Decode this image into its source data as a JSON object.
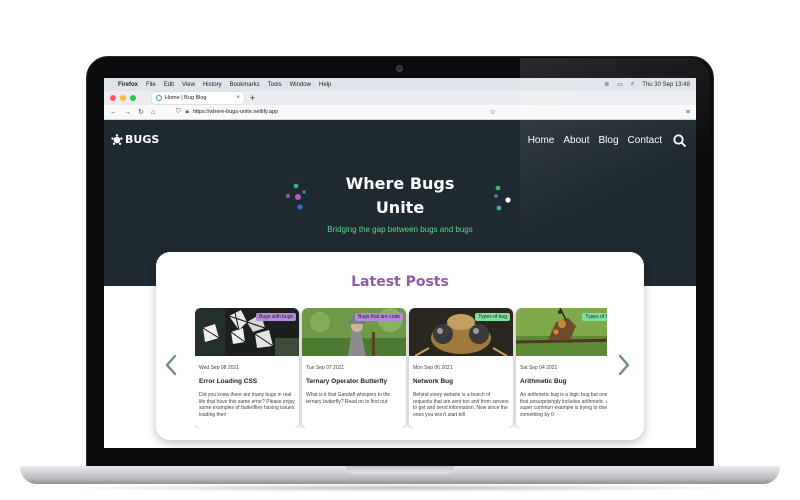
{
  "menubar": {
    "app": "Firefox",
    "items": [
      "File",
      "Edit",
      "View",
      "History",
      "Bookmarks",
      "Tools",
      "Window",
      "Help"
    ],
    "clock": "Thu 30 Sep  13:48"
  },
  "browser": {
    "tab_title": "Home | Bug Blog",
    "new_tab_label": "+",
    "url": "https://where-bugs-unite.netlify.app"
  },
  "site": {
    "logo_text": "BUGS",
    "nav": [
      "Home",
      "About",
      "Blog",
      "Contact"
    ],
    "hero": {
      "title_line1": "Where Bugs",
      "title_line2": "Unite",
      "subtitle": "Bridging the gap between bugs and bugs"
    },
    "latest": {
      "title": "Latest Posts",
      "posts": [
        {
          "tag": "Bugs with bugs",
          "date": "Wed Sep 08 2021",
          "title": "Error Loading CSS",
          "excerpt": "Did you know there are many bugs in real life that have this same error? Please enjoy some examples of butterflies having issues loading their"
        },
        {
          "tag": "Bugs that are code",
          "date": "Tue Sep 07 2021",
          "title": "Ternary Operator Butterfly",
          "excerpt": "What is it that Gandalf whispers to the ternary butterfly? Read on to find out"
        },
        {
          "tag": "Types of bug",
          "date": "Mon Sep 06 2021",
          "title": "Network Bug",
          "excerpt": "Behind every website is a bunch of requests that are sent too and from servers to get and send information. Now since the ones you won't start tell"
        },
        {
          "tag": "Types of bug",
          "date": "Sat Sep 04 2021",
          "title": "Arithmetic Bug",
          "excerpt": "An arithmetic bug is a logic bug but one that unsurprisingly includes arithmetic. A super common example is trying to divide something by 0"
        }
      ]
    }
  },
  "icons": {
    "prev": "chevron-left-icon",
    "next": "chevron-right-icon",
    "search": "search-icon"
  },
  "colors": {
    "hero_bg": "#1f2a30",
    "accent_green": "#5cd68a",
    "heading_purple": "#8e5ba6",
    "tag_purple": "#b48bd6",
    "tag_green": "#7ee0a0"
  }
}
